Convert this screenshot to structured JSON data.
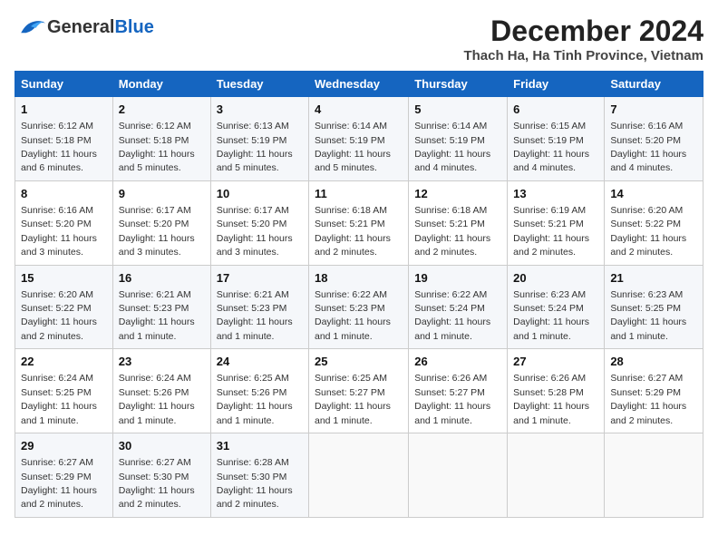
{
  "header": {
    "logo_general": "General",
    "logo_blue": "Blue",
    "month_title": "December 2024",
    "location": "Thach Ha, Ha Tinh Province, Vietnam"
  },
  "weekdays": [
    "Sunday",
    "Monday",
    "Tuesday",
    "Wednesday",
    "Thursday",
    "Friday",
    "Saturday"
  ],
  "weeks": [
    [
      {
        "day": "1",
        "sunrise": "Sunrise: 6:12 AM",
        "sunset": "Sunset: 5:18 PM",
        "daylight": "Daylight: 11 hours and 6 minutes."
      },
      {
        "day": "2",
        "sunrise": "Sunrise: 6:12 AM",
        "sunset": "Sunset: 5:18 PM",
        "daylight": "Daylight: 11 hours and 5 minutes."
      },
      {
        "day": "3",
        "sunrise": "Sunrise: 6:13 AM",
        "sunset": "Sunset: 5:19 PM",
        "daylight": "Daylight: 11 hours and 5 minutes."
      },
      {
        "day": "4",
        "sunrise": "Sunrise: 6:14 AM",
        "sunset": "Sunset: 5:19 PM",
        "daylight": "Daylight: 11 hours and 5 minutes."
      },
      {
        "day": "5",
        "sunrise": "Sunrise: 6:14 AM",
        "sunset": "Sunset: 5:19 PM",
        "daylight": "Daylight: 11 hours and 4 minutes."
      },
      {
        "day": "6",
        "sunrise": "Sunrise: 6:15 AM",
        "sunset": "Sunset: 5:19 PM",
        "daylight": "Daylight: 11 hours and 4 minutes."
      },
      {
        "day": "7",
        "sunrise": "Sunrise: 6:16 AM",
        "sunset": "Sunset: 5:20 PM",
        "daylight": "Daylight: 11 hours and 4 minutes."
      }
    ],
    [
      {
        "day": "8",
        "sunrise": "Sunrise: 6:16 AM",
        "sunset": "Sunset: 5:20 PM",
        "daylight": "Daylight: 11 hours and 3 minutes."
      },
      {
        "day": "9",
        "sunrise": "Sunrise: 6:17 AM",
        "sunset": "Sunset: 5:20 PM",
        "daylight": "Daylight: 11 hours and 3 minutes."
      },
      {
        "day": "10",
        "sunrise": "Sunrise: 6:17 AM",
        "sunset": "Sunset: 5:20 PM",
        "daylight": "Daylight: 11 hours and 3 minutes."
      },
      {
        "day": "11",
        "sunrise": "Sunrise: 6:18 AM",
        "sunset": "Sunset: 5:21 PM",
        "daylight": "Daylight: 11 hours and 2 minutes."
      },
      {
        "day": "12",
        "sunrise": "Sunrise: 6:18 AM",
        "sunset": "Sunset: 5:21 PM",
        "daylight": "Daylight: 11 hours and 2 minutes."
      },
      {
        "day": "13",
        "sunrise": "Sunrise: 6:19 AM",
        "sunset": "Sunset: 5:21 PM",
        "daylight": "Daylight: 11 hours and 2 minutes."
      },
      {
        "day": "14",
        "sunrise": "Sunrise: 6:20 AM",
        "sunset": "Sunset: 5:22 PM",
        "daylight": "Daylight: 11 hours and 2 minutes."
      }
    ],
    [
      {
        "day": "15",
        "sunrise": "Sunrise: 6:20 AM",
        "sunset": "Sunset: 5:22 PM",
        "daylight": "Daylight: 11 hours and 2 minutes."
      },
      {
        "day": "16",
        "sunrise": "Sunrise: 6:21 AM",
        "sunset": "Sunset: 5:23 PM",
        "daylight": "Daylight: 11 hours and 1 minute."
      },
      {
        "day": "17",
        "sunrise": "Sunrise: 6:21 AM",
        "sunset": "Sunset: 5:23 PM",
        "daylight": "Daylight: 11 hours and 1 minute."
      },
      {
        "day": "18",
        "sunrise": "Sunrise: 6:22 AM",
        "sunset": "Sunset: 5:23 PM",
        "daylight": "Daylight: 11 hours and 1 minute."
      },
      {
        "day": "19",
        "sunrise": "Sunrise: 6:22 AM",
        "sunset": "Sunset: 5:24 PM",
        "daylight": "Daylight: 11 hours and 1 minute."
      },
      {
        "day": "20",
        "sunrise": "Sunrise: 6:23 AM",
        "sunset": "Sunset: 5:24 PM",
        "daylight": "Daylight: 11 hours and 1 minute."
      },
      {
        "day": "21",
        "sunrise": "Sunrise: 6:23 AM",
        "sunset": "Sunset: 5:25 PM",
        "daylight": "Daylight: 11 hours and 1 minute."
      }
    ],
    [
      {
        "day": "22",
        "sunrise": "Sunrise: 6:24 AM",
        "sunset": "Sunset: 5:25 PM",
        "daylight": "Daylight: 11 hours and 1 minute."
      },
      {
        "day": "23",
        "sunrise": "Sunrise: 6:24 AM",
        "sunset": "Sunset: 5:26 PM",
        "daylight": "Daylight: 11 hours and 1 minute."
      },
      {
        "day": "24",
        "sunrise": "Sunrise: 6:25 AM",
        "sunset": "Sunset: 5:26 PM",
        "daylight": "Daylight: 11 hours and 1 minute."
      },
      {
        "day": "25",
        "sunrise": "Sunrise: 6:25 AM",
        "sunset": "Sunset: 5:27 PM",
        "daylight": "Daylight: 11 hours and 1 minute."
      },
      {
        "day": "26",
        "sunrise": "Sunrise: 6:26 AM",
        "sunset": "Sunset: 5:27 PM",
        "daylight": "Daylight: 11 hours and 1 minute."
      },
      {
        "day": "27",
        "sunrise": "Sunrise: 6:26 AM",
        "sunset": "Sunset: 5:28 PM",
        "daylight": "Daylight: 11 hours and 1 minute."
      },
      {
        "day": "28",
        "sunrise": "Sunrise: 6:27 AM",
        "sunset": "Sunset: 5:29 PM",
        "daylight": "Daylight: 11 hours and 2 minutes."
      }
    ],
    [
      {
        "day": "29",
        "sunrise": "Sunrise: 6:27 AM",
        "sunset": "Sunset: 5:29 PM",
        "daylight": "Daylight: 11 hours and 2 minutes."
      },
      {
        "day": "30",
        "sunrise": "Sunrise: 6:27 AM",
        "sunset": "Sunset: 5:30 PM",
        "daylight": "Daylight: 11 hours and 2 minutes."
      },
      {
        "day": "31",
        "sunrise": "Sunrise: 6:28 AM",
        "sunset": "Sunset: 5:30 PM",
        "daylight": "Daylight: 11 hours and 2 minutes."
      },
      null,
      null,
      null,
      null
    ]
  ]
}
